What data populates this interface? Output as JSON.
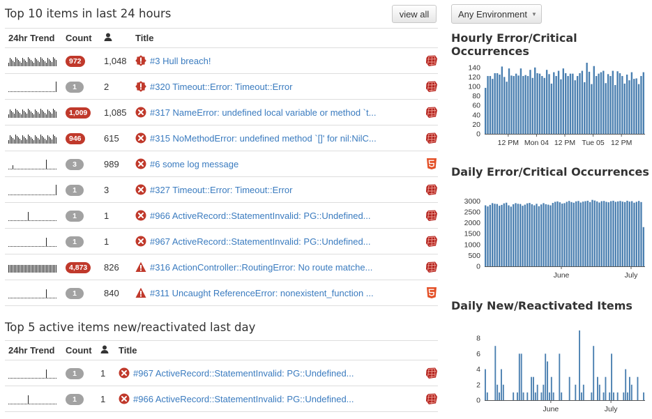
{
  "top10": {
    "title": "Top 10 items in last 24 hours",
    "view_all": "view all",
    "columns": {
      "trend": "24hr Trend",
      "count": "Count",
      "title": "Title"
    },
    "rows": [
      {
        "count": "972",
        "occ": "1,048",
        "level": "critical",
        "title": "#3 Hull breach!",
        "platform": "ruby",
        "badge": "red",
        "spark": "dense"
      },
      {
        "count": "1",
        "occ": "2",
        "level": "critical",
        "title": "#320 Timeout::Error: Timeout::Error",
        "platform": "ruby",
        "badge": "gray",
        "spark": "end"
      },
      {
        "count": "1,009",
        "occ": "1,085",
        "level": "error",
        "title": "#317 NameError: undefined local variable or method `t...",
        "platform": "ruby",
        "badge": "red",
        "spark": "dense"
      },
      {
        "count": "946",
        "occ": "615",
        "level": "error",
        "title": "#315 NoMethodError: undefined method `[]' for nil:NilC...",
        "platform": "ruby",
        "badge": "red",
        "spark": "dense"
      },
      {
        "count": "3",
        "occ": "989",
        "level": "error",
        "title": "#6 some log message",
        "platform": "html5",
        "badge": "gray",
        "spark": "two"
      },
      {
        "count": "1",
        "occ": "3",
        "level": "error",
        "title": "#327 Timeout::Error: Timeout::Error",
        "platform": "ruby",
        "badge": "gray",
        "spark": "end"
      },
      {
        "count": "1",
        "occ": "1",
        "level": "error",
        "title": "#966 ActiveRecord::StatementInvalid: PG::Undefined...",
        "platform": "ruby",
        "badge": "gray",
        "spark": "mid"
      },
      {
        "count": "1",
        "occ": "1",
        "level": "error",
        "title": "#967 ActiveRecord::StatementInvalid: PG::Undefined...",
        "platform": "ruby",
        "badge": "gray",
        "spark": "late"
      },
      {
        "count": "4,873",
        "occ": "826",
        "level": "warning",
        "title": "#316 ActionController::RoutingError: No route matche...",
        "platform": "ruby",
        "badge": "red",
        "spark": "full"
      },
      {
        "count": "1",
        "occ": "840",
        "level": "warning",
        "title": "#311 Uncaught ReferenceError: nonexistent_function ...",
        "platform": "html5",
        "badge": "gray",
        "spark": "late"
      }
    ]
  },
  "top5": {
    "title": "Top 5 active items new/reactivated last day",
    "columns": {
      "trend": "24hr Trend",
      "count": "Count",
      "title": "Title"
    },
    "rows": [
      {
        "count": "1",
        "occ": "1",
        "level": "error",
        "title": "#967 ActiveRecord::StatementInvalid: PG::Undefined...",
        "platform": "ruby",
        "badge": "gray",
        "spark": "late"
      },
      {
        "count": "1",
        "occ": "1",
        "level": "error",
        "title": "#966 ActiveRecord::StatementInvalid: PG::Undefined...",
        "platform": "ruby",
        "badge": "gray",
        "spark": "mid"
      }
    ]
  },
  "environment": {
    "label": "Any Environment"
  },
  "chart_data": [
    {
      "type": "bar",
      "title": "Hourly Error/Critical Occurrences",
      "ylim": [
        0,
        150
      ],
      "yticks": [
        0,
        20,
        40,
        60,
        80,
        100,
        120,
        140
      ],
      "xticks": [
        {
          "label": "12 PM",
          "at": 10
        },
        {
          "label": "Mon 04",
          "at": 22
        },
        {
          "label": "12 PM",
          "at": 34
        },
        {
          "label": "Tue 05",
          "at": 46
        },
        {
          "label": "12 PM",
          "at": 58
        }
      ],
      "values": [
        97,
        122,
        122,
        116,
        128,
        128,
        125,
        142,
        120,
        110,
        138,
        123,
        122,
        127,
        123,
        138,
        122,
        124,
        122,
        135,
        118,
        140,
        128,
        127,
        122,
        118,
        135,
        126,
        106,
        130,
        122,
        133,
        115,
        138,
        128,
        122,
        127,
        127,
        113,
        122,
        128,
        133,
        109,
        150,
        131,
        105,
        143,
        122,
        127,
        130,
        133,
        107,
        126,
        122,
        133,
        103,
        132,
        128,
        122,
        106,
        125,
        113,
        130,
        116,
        117,
        105,
        122,
        130
      ]
    },
    {
      "type": "bar",
      "title": "Daily Error/Critical Occurrences",
      "ylim": [
        0,
        3200
      ],
      "yticks": [
        0,
        500,
        1000,
        1500,
        2000,
        2500,
        3000
      ],
      "xticks": [
        {
          "label": "June",
          "at": 33
        },
        {
          "label": "July",
          "at": 63
        }
      ],
      "values": [
        2800,
        2750,
        2820,
        2900,
        2870,
        2860,
        2780,
        2820,
        2890,
        2920,
        2800,
        2740,
        2850,
        2900,
        2870,
        2860,
        2780,
        2830,
        2890,
        2910,
        2850,
        2800,
        2870,
        2760,
        2840,
        2900,
        2850,
        2830,
        2800,
        2910,
        2960,
        2980,
        2940,
        2880,
        2900,
        2960,
        3000,
        2950,
        2920,
        2980,
        3000,
        2930,
        2970,
        2990,
        3010,
        2950,
        3050,
        3020,
        2980,
        2930,
        2990,
        3000,
        2960,
        2940,
        2990,
        3010,
        2960,
        2980,
        3000,
        2970,
        2950,
        3010,
        2970,
        2990,
        2920,
        2960,
        3000,
        2950,
        1800
      ]
    },
    {
      "type": "bar",
      "title": "Daily New/Reactivated Items",
      "ylim": [
        0,
        9
      ],
      "yticks": [
        0,
        2,
        4,
        6,
        8
      ],
      "xticks": [
        {
          "label": "June",
          "at": 33
        },
        {
          "label": "July",
          "at": 63
        }
      ],
      "values": [
        4,
        1,
        0,
        0,
        0,
        7,
        2,
        1,
        4,
        2,
        0,
        0,
        0,
        0,
        1,
        0,
        1,
        6,
        6,
        1,
        0,
        1,
        0,
        3,
        3,
        1,
        2,
        0,
        1,
        2,
        6,
        5,
        1,
        3,
        1,
        0,
        0,
        6,
        1,
        0,
        0,
        0,
        3,
        0,
        0,
        2,
        0,
        9,
        1,
        2,
        0,
        0,
        0,
        1,
        7,
        0,
        3,
        2,
        0,
        1,
        3,
        0,
        1,
        6,
        1,
        0,
        1,
        0,
        0,
        1,
        4,
        1,
        3,
        2,
        0,
        0,
        3,
        0,
        0,
        1
      ]
    }
  ]
}
